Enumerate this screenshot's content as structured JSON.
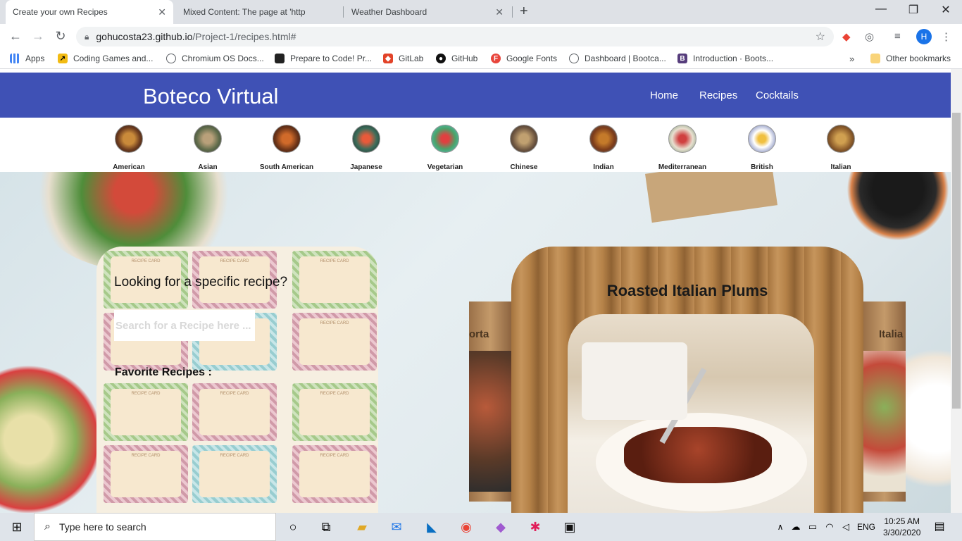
{
  "browser": {
    "tabs": [
      {
        "title": "Create your own Recipes",
        "active": true
      },
      {
        "title": "Mixed Content: The page at 'http",
        "active": false
      },
      {
        "title": "Weather Dashboard",
        "active": false
      }
    ],
    "new_tab": "+",
    "window_controls": {
      "minimize": "—",
      "maximize": "❐",
      "close": "✕"
    },
    "url_host": "gohucosta23.github.io",
    "url_path": "/Project-1/recipes.html#",
    "profile_initial": "H"
  },
  "bookmarks": [
    {
      "label": "Apps",
      "icon": "apps-grid-icon",
      "color": "#4285f4"
    },
    {
      "label": "Coding Games and...",
      "icon": "codingame-icon",
      "color": "#f2bb13"
    },
    {
      "label": "Chromium OS Docs...",
      "icon": "globe-icon",
      "color": "#5f6368"
    },
    {
      "label": "Prepare to Code! Pr...",
      "icon": "book-icon",
      "color": "#222222"
    },
    {
      "label": "GitLab",
      "icon": "gitlab-icon",
      "color": "#e24329"
    },
    {
      "label": "GitHub",
      "icon": "github-icon",
      "color": "#111111"
    },
    {
      "label": "Google Fonts",
      "icon": "google-fonts-icon",
      "color": "#e8453c"
    },
    {
      "label": "Dashboard | Bootca...",
      "icon": "globe-icon",
      "color": "#5f6368"
    },
    {
      "label": "Introduction · Boots...",
      "icon": "bootstrap-icon",
      "color": "#563d7c"
    }
  ],
  "bookmarks_overflow": "»",
  "other_bookmarks": "Other bookmarks",
  "site": {
    "brand": "Boteco Virtual",
    "nav": [
      "Home",
      "Recipes",
      "Cocktails"
    ],
    "cuisines": [
      "American",
      "Asian",
      "South American",
      "Japanese",
      "Vegetarian",
      "Chinese",
      "Indian",
      "Mediterranean",
      "British",
      "Italian"
    ],
    "search_heading": "Looking for a specific recipe?",
    "search_placeholder": "Search for a Recipe here ...",
    "favorites_label": "Favorite Recipes :",
    "carousel": {
      "left_partial_title": "orta",
      "main_title": "Roasted Italian Plums",
      "right_partial_title": "Italia"
    }
  },
  "taskbar": {
    "search_placeholder": "Type here to search",
    "language": "ENG",
    "time": "10:25 AM",
    "date": "3/30/2020"
  },
  "colors": {
    "navbar": "#3f51b5",
    "tab_strip": "#dee1e6",
    "taskbar": "#dfe4ea"
  }
}
